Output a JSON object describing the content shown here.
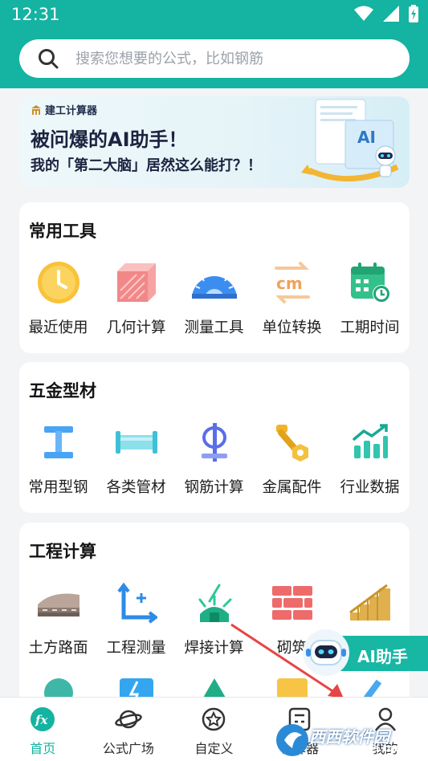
{
  "status": {
    "time": "12:31"
  },
  "search": {
    "placeholder": "搜索您想要的公式，比如钢筋"
  },
  "banner": {
    "brand": "建工计算器",
    "title": "被问爆的AI助手！",
    "subtitle": "我的「第二大脑」居然这么能打？！"
  },
  "sections": [
    {
      "title": "常用工具",
      "items": [
        {
          "label": "最近使用",
          "icon": "clock-icon"
        },
        {
          "label": "几何计算",
          "icon": "cube-icon"
        },
        {
          "label": "测量工具",
          "icon": "protractor-icon"
        },
        {
          "label": "单位转换",
          "icon": "unit-convert-icon"
        },
        {
          "label": "工期时间",
          "icon": "calendar-icon"
        }
      ]
    },
    {
      "title": "五金型材",
      "items": [
        {
          "label": "常用型钢",
          "icon": "i-beam-icon"
        },
        {
          "label": "各类管材",
          "icon": "pipe-icon"
        },
        {
          "label": "钢筋计算",
          "icon": "rebar-icon"
        },
        {
          "label": "金属配件",
          "icon": "hardware-icon"
        },
        {
          "label": "行业数据",
          "icon": "trend-chart-icon"
        }
      ]
    },
    {
      "title": "工程计算",
      "items": [
        {
          "label": "土方路面",
          "icon": "road-icon"
        },
        {
          "label": "工程测量",
          "icon": "axis-icon"
        },
        {
          "label": "焊接计算",
          "icon": "welding-icon"
        },
        {
          "label": "砌筑",
          "icon": "brick-icon"
        },
        {
          "label": "",
          "icon": "stairs-icon"
        }
      ]
    }
  ],
  "ai_button": {
    "label": "AI助手"
  },
  "tabs": [
    {
      "label": "首页",
      "icon": "fx-icon",
      "active": true
    },
    {
      "label": "公式广场",
      "icon": "planet-icon",
      "active": false
    },
    {
      "label": "自定义",
      "icon": "star-icon",
      "active": false
    },
    {
      "label": "计算器",
      "icon": "calculator-icon",
      "active": false
    },
    {
      "label": "我的",
      "icon": "user-icon",
      "active": false
    }
  ],
  "watermark": {
    "text": "西西软件园",
    "sub": "CR173.COM"
  },
  "colors": {
    "primary": "#15b3a1",
    "accent_red": "#e64545"
  }
}
